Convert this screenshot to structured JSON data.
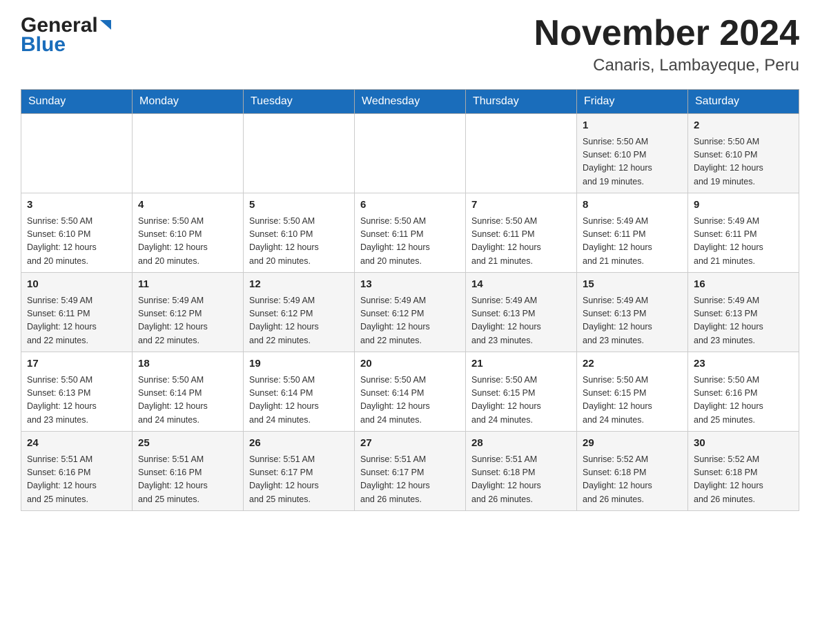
{
  "header": {
    "logo_general": "General",
    "logo_blue": "Blue",
    "month_title": "November 2024",
    "location": "Canaris, Lambayeque, Peru"
  },
  "days_of_week": [
    "Sunday",
    "Monday",
    "Tuesday",
    "Wednesday",
    "Thursday",
    "Friday",
    "Saturday"
  ],
  "weeks": [
    {
      "days": [
        {
          "number": "",
          "info": ""
        },
        {
          "number": "",
          "info": ""
        },
        {
          "number": "",
          "info": ""
        },
        {
          "number": "",
          "info": ""
        },
        {
          "number": "",
          "info": ""
        },
        {
          "number": "1",
          "info": "Sunrise: 5:50 AM\nSunset: 6:10 PM\nDaylight: 12 hours\nand 19 minutes."
        },
        {
          "number": "2",
          "info": "Sunrise: 5:50 AM\nSunset: 6:10 PM\nDaylight: 12 hours\nand 19 minutes."
        }
      ]
    },
    {
      "days": [
        {
          "number": "3",
          "info": "Sunrise: 5:50 AM\nSunset: 6:10 PM\nDaylight: 12 hours\nand 20 minutes."
        },
        {
          "number": "4",
          "info": "Sunrise: 5:50 AM\nSunset: 6:10 PM\nDaylight: 12 hours\nand 20 minutes."
        },
        {
          "number": "5",
          "info": "Sunrise: 5:50 AM\nSunset: 6:10 PM\nDaylight: 12 hours\nand 20 minutes."
        },
        {
          "number": "6",
          "info": "Sunrise: 5:50 AM\nSunset: 6:11 PM\nDaylight: 12 hours\nand 20 minutes."
        },
        {
          "number": "7",
          "info": "Sunrise: 5:50 AM\nSunset: 6:11 PM\nDaylight: 12 hours\nand 21 minutes."
        },
        {
          "number": "8",
          "info": "Sunrise: 5:49 AM\nSunset: 6:11 PM\nDaylight: 12 hours\nand 21 minutes."
        },
        {
          "number": "9",
          "info": "Sunrise: 5:49 AM\nSunset: 6:11 PM\nDaylight: 12 hours\nand 21 minutes."
        }
      ]
    },
    {
      "days": [
        {
          "number": "10",
          "info": "Sunrise: 5:49 AM\nSunset: 6:11 PM\nDaylight: 12 hours\nand 22 minutes."
        },
        {
          "number": "11",
          "info": "Sunrise: 5:49 AM\nSunset: 6:12 PM\nDaylight: 12 hours\nand 22 minutes."
        },
        {
          "number": "12",
          "info": "Sunrise: 5:49 AM\nSunset: 6:12 PM\nDaylight: 12 hours\nand 22 minutes."
        },
        {
          "number": "13",
          "info": "Sunrise: 5:49 AM\nSunset: 6:12 PM\nDaylight: 12 hours\nand 22 minutes."
        },
        {
          "number": "14",
          "info": "Sunrise: 5:49 AM\nSunset: 6:13 PM\nDaylight: 12 hours\nand 23 minutes."
        },
        {
          "number": "15",
          "info": "Sunrise: 5:49 AM\nSunset: 6:13 PM\nDaylight: 12 hours\nand 23 minutes."
        },
        {
          "number": "16",
          "info": "Sunrise: 5:49 AM\nSunset: 6:13 PM\nDaylight: 12 hours\nand 23 minutes."
        }
      ]
    },
    {
      "days": [
        {
          "number": "17",
          "info": "Sunrise: 5:50 AM\nSunset: 6:13 PM\nDaylight: 12 hours\nand 23 minutes."
        },
        {
          "number": "18",
          "info": "Sunrise: 5:50 AM\nSunset: 6:14 PM\nDaylight: 12 hours\nand 24 minutes."
        },
        {
          "number": "19",
          "info": "Sunrise: 5:50 AM\nSunset: 6:14 PM\nDaylight: 12 hours\nand 24 minutes."
        },
        {
          "number": "20",
          "info": "Sunrise: 5:50 AM\nSunset: 6:14 PM\nDaylight: 12 hours\nand 24 minutes."
        },
        {
          "number": "21",
          "info": "Sunrise: 5:50 AM\nSunset: 6:15 PM\nDaylight: 12 hours\nand 24 minutes."
        },
        {
          "number": "22",
          "info": "Sunrise: 5:50 AM\nSunset: 6:15 PM\nDaylight: 12 hours\nand 24 minutes."
        },
        {
          "number": "23",
          "info": "Sunrise: 5:50 AM\nSunset: 6:16 PM\nDaylight: 12 hours\nand 25 minutes."
        }
      ]
    },
    {
      "days": [
        {
          "number": "24",
          "info": "Sunrise: 5:51 AM\nSunset: 6:16 PM\nDaylight: 12 hours\nand 25 minutes."
        },
        {
          "number": "25",
          "info": "Sunrise: 5:51 AM\nSunset: 6:16 PM\nDaylight: 12 hours\nand 25 minutes."
        },
        {
          "number": "26",
          "info": "Sunrise: 5:51 AM\nSunset: 6:17 PM\nDaylight: 12 hours\nand 25 minutes."
        },
        {
          "number": "27",
          "info": "Sunrise: 5:51 AM\nSunset: 6:17 PM\nDaylight: 12 hours\nand 26 minutes."
        },
        {
          "number": "28",
          "info": "Sunrise: 5:51 AM\nSunset: 6:18 PM\nDaylight: 12 hours\nand 26 minutes."
        },
        {
          "number": "29",
          "info": "Sunrise: 5:52 AM\nSunset: 6:18 PM\nDaylight: 12 hours\nand 26 minutes."
        },
        {
          "number": "30",
          "info": "Sunrise: 5:52 AM\nSunset: 6:18 PM\nDaylight: 12 hours\nand 26 minutes."
        }
      ]
    }
  ]
}
